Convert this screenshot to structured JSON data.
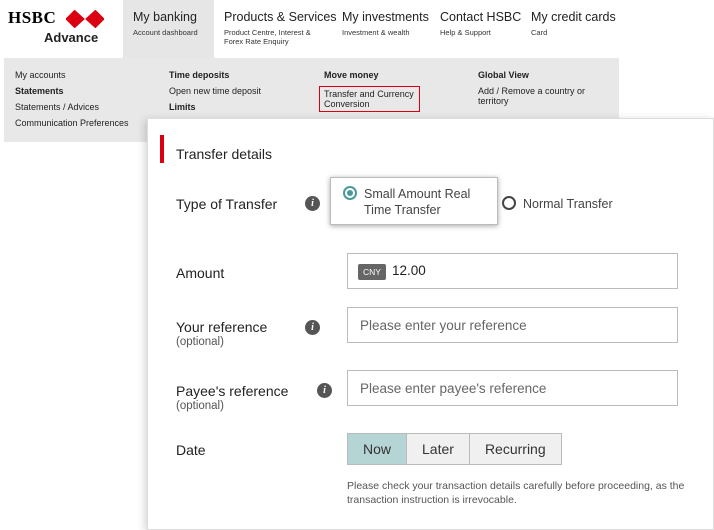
{
  "brand": {
    "name": "HSBC",
    "tier": "Advance"
  },
  "nav": [
    {
      "label": "My banking",
      "sub": "Account dashboard",
      "active": true
    },
    {
      "label": "Products & Services",
      "sub": "Product Centre, Interest & Forex Rate Enquiry"
    },
    {
      "label": "My investments",
      "sub": "Investment & wealth"
    },
    {
      "label": "Contact HSBC",
      "sub": "Help & Support"
    },
    {
      "label": "My credit cards",
      "sub": "Card"
    }
  ],
  "menu": {
    "col1": [
      "My accounts",
      "Statements",
      "Statements / Advices",
      "Communication Preferences"
    ],
    "col2": {
      "heading": "Time deposits",
      "items": [
        "Open new time deposit"
      ],
      "heading2": "Limits"
    },
    "col3": {
      "heading": "Move money",
      "items": [
        "Transfer and Currency Conversion"
      ]
    },
    "col4": {
      "heading": "Global View",
      "items": [
        "Add / Remove a country or territory"
      ]
    }
  },
  "form": {
    "title": "Transfer details",
    "type_label": "Type of Transfer",
    "type_options": [
      "Small Amount Real Time Transfer",
      "Normal Transfer"
    ],
    "type_selected": "Small Amount Real Time Transfer",
    "amount_label": "Amount",
    "amount_currency": "CNY",
    "amount_value": "12.00",
    "your_ref_label": "Your reference",
    "your_ref_optional": "(optional)",
    "your_ref_placeholder": "Please enter your reference",
    "payee_ref_label": "Payee's reference",
    "payee_ref_optional": "(optional)",
    "payee_ref_placeholder": "Please enter payee's reference",
    "date_label": "Date",
    "date_options": [
      "Now",
      "Later",
      "Recurring"
    ],
    "date_selected": "Now",
    "note": "Please check your transaction details carefully before proceeding, as the transaction instruction is irrevocable."
  },
  "colors": {
    "accent": "#db0011",
    "teal": "#4a9a99",
    "selected_bg": "#b5d4d4"
  }
}
